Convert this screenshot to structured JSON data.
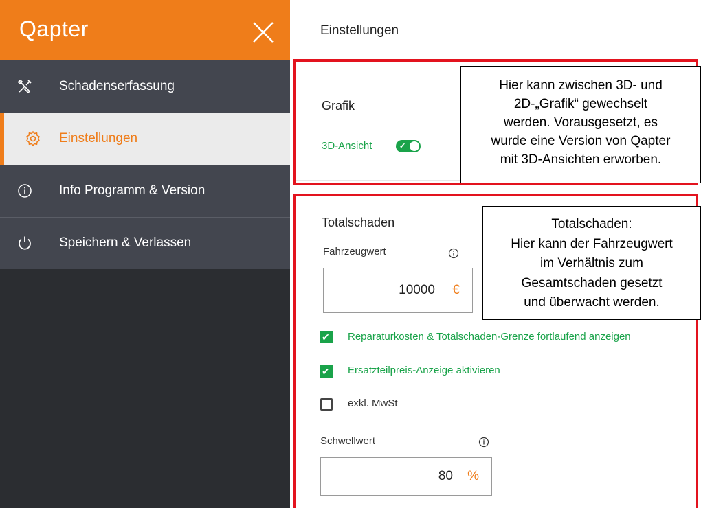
{
  "app": {
    "logo": "Qapter"
  },
  "sidebar": {
    "items": [
      {
        "label": "Schadenserfassung",
        "icon": "tools-icon"
      },
      {
        "label": "Einstellungen",
        "icon": "gear-icon",
        "active": true
      },
      {
        "label": "Info Programm & Version",
        "icon": "info-icon"
      },
      {
        "label": "Speichern & Verlassen",
        "icon": "power-icon"
      }
    ]
  },
  "main": {
    "title": "Einstellungen",
    "grafik": {
      "heading": "Grafik",
      "toggle_label": "3D-Ansicht",
      "toggle_on": true
    },
    "totalschaden": {
      "heading": "Totalschaden",
      "fahrzeugwert_label": "Fahrzeugwert",
      "fahrzeugwert_value": "10000",
      "fahrzeugwert_unit": "€",
      "checkbox_reparatur": "Reparaturkosten & Totalschaden-Grenze fortlaufend anzeigen",
      "checkbox_ersatzteil": "Ersatzteilpreis-Anzeige aktivieren",
      "checkbox_mwst": "exkl. MwSt",
      "schwellwert_label": "Schwellwert",
      "schwellwert_value": "80",
      "schwellwert_unit": "%"
    }
  },
  "callouts": {
    "grafik": [
      "Hier kann zwischen 3D- und",
      "2D-„Grafik“ gewechselt",
      "werden. Vorausgesetzt, es",
      "wurde eine Version von Qapter",
      "mit 3D-Ansichten erworben."
    ],
    "totalschaden": [
      "Totalschaden:",
      "Hier kann der Fahrzeugwert",
      "im Verhältnis zum",
      "Gesamtschaden gesetzt",
      "und überwacht werden."
    ]
  },
  "colors": {
    "brand": "#ef7d1a",
    "green": "#1aa34a",
    "highlight": "#e3131e",
    "sidebar_dark": "#2b2d31",
    "sidebar_menu": "#43464f"
  }
}
